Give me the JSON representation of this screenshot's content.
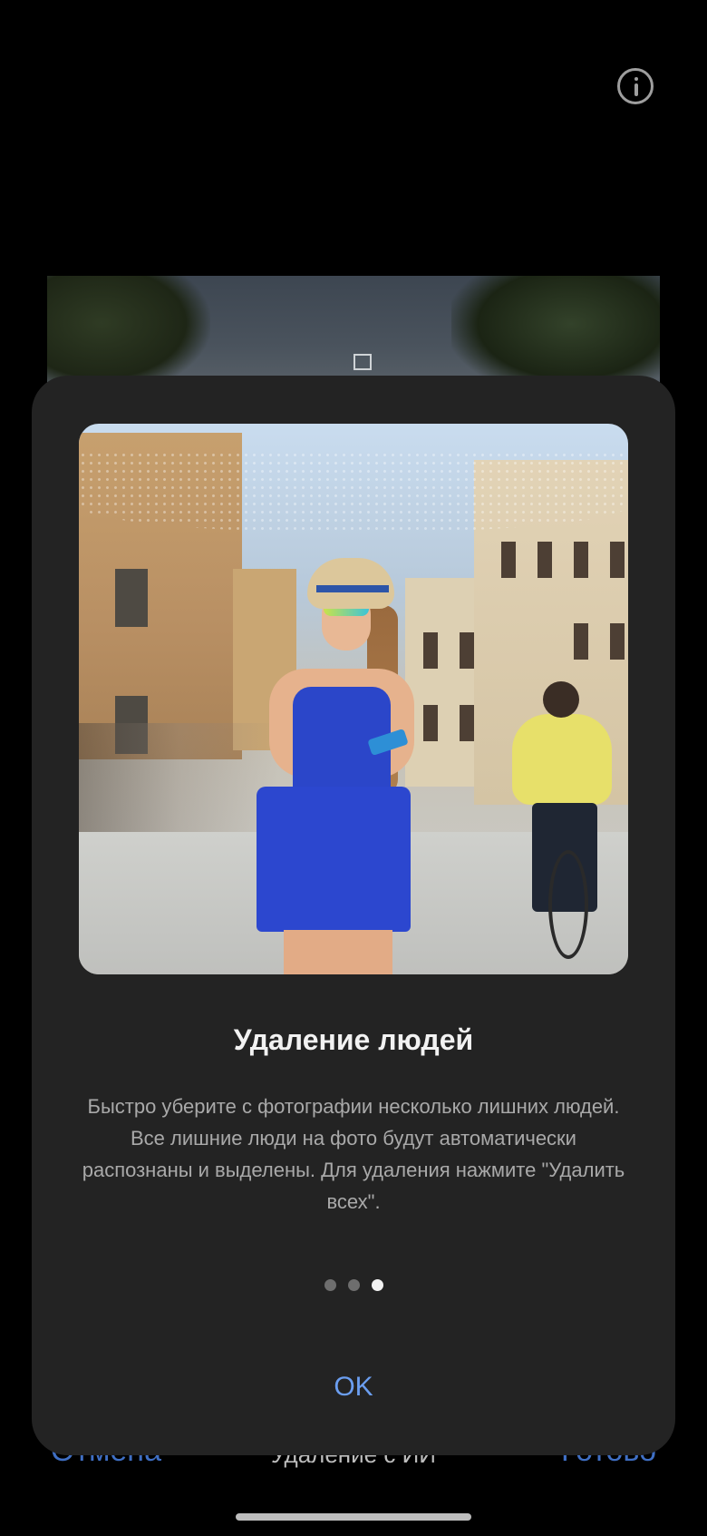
{
  "header": {
    "info_icon": "info-circle-icon"
  },
  "bottom_bar": {
    "cancel_label": "Отмена",
    "mode_label": "Удаление с ИИ",
    "done_label": "Готово"
  },
  "dialog": {
    "preview_image": "woman-in-blue-dress-on-street",
    "title": "Удаление людей",
    "description": "Быстро уберите с фотографии несколько лишних людей. Все лишние люди на фото будут автоматически распознаны и выделены. Для удаления нажмите \"Удалить всех\".",
    "pages_total": 3,
    "page_current": 3,
    "ok_label": "OK"
  },
  "colors": {
    "accent": "#6b9ef0",
    "dialog_bg": "#232323",
    "background": "#000000"
  }
}
